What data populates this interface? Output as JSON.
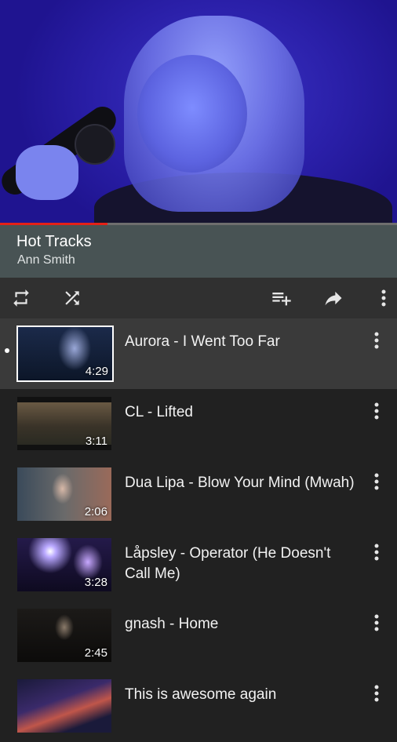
{
  "player": {
    "progress_percent": 27
  },
  "now_playing": {
    "title": "Hot Tracks",
    "artist": "Ann Smith"
  },
  "controls": {
    "icons": [
      "repeat-icon",
      "shuffle-icon",
      "playlist-add-icon",
      "share-icon",
      "more-vert-icon"
    ]
  },
  "playlist": [
    {
      "title": "Aurora - I Went Too Far",
      "duration": "4:29",
      "active": true
    },
    {
      "title": "CL - Lifted",
      "duration": "3:11",
      "active": false
    },
    {
      "title": "Dua Lipa - Blow Your Mind (Mwah)",
      "duration": "2:06",
      "active": false
    },
    {
      "title": "Låpsley - Operator (He Doesn't Call Me)",
      "duration": "3:28",
      "active": false
    },
    {
      "title": "gnash - Home",
      "duration": "2:45",
      "active": false
    },
    {
      "title": "This is awesome again",
      "duration": "",
      "active": false
    }
  ],
  "colors": {
    "accent": "#e52117",
    "info_bar": "#485354",
    "controls_bar": "#303030",
    "list_bg": "#212121",
    "active_row": "#3a3a3a"
  }
}
